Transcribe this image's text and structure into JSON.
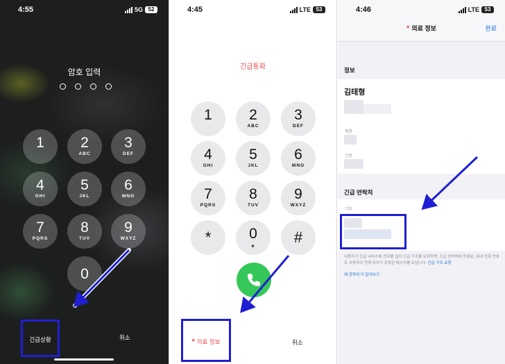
{
  "colors": {
    "annotation_blue": "#1e1ed2",
    "emergency_red": "#e44c50",
    "call_green": "#35c759",
    "link_blue": "#1a6fd9"
  },
  "lock_screen": {
    "status": {
      "time": "4:55",
      "network": "5G",
      "battery": "52"
    },
    "title": "암호 입력",
    "keys": [
      {
        "digit": "1",
        "letters": ""
      },
      {
        "digit": "2",
        "letters": "ABC"
      },
      {
        "digit": "3",
        "letters": "DEF"
      },
      {
        "digit": "4",
        "letters": "GHI"
      },
      {
        "digit": "5",
        "letters": "JKL"
      },
      {
        "digit": "6",
        "letters": "MNO"
      },
      {
        "digit": "7",
        "letters": "PQRS"
      },
      {
        "digit": "8",
        "letters": "TUV"
      },
      {
        "digit": "9",
        "letters": "WXYZ"
      },
      {
        "digit": "0",
        "letters": ""
      }
    ],
    "emergency_label": "긴급상황",
    "cancel_label": "취소"
  },
  "emergency_dialer": {
    "status": {
      "time": "4:45",
      "network": "LTE",
      "battery": "53"
    },
    "title": "긴급통화",
    "keys": [
      {
        "digit": "1",
        "letters": ""
      },
      {
        "digit": "2",
        "letters": "ABC"
      },
      {
        "digit": "3",
        "letters": "DEF"
      },
      {
        "digit": "4",
        "letters": "GHI"
      },
      {
        "digit": "5",
        "letters": "JKL"
      },
      {
        "digit": "6",
        "letters": "MNO"
      },
      {
        "digit": "7",
        "letters": "PQRS"
      },
      {
        "digit": "8",
        "letters": "TUV"
      },
      {
        "digit": "9",
        "letters": "WXYZ"
      },
      {
        "digit": "*",
        "letters": ""
      },
      {
        "digit": "0",
        "letters": "+"
      },
      {
        "digit": "#",
        "letters": ""
      }
    ],
    "medical_id_label": "의료 정보",
    "cancel_label": "취소",
    "asterisk": "*"
  },
  "medical_id": {
    "status": {
      "time": "4:46",
      "network": "LTE",
      "battery": "53"
    },
    "title": "의료 정보",
    "asterisk": "*",
    "done_label": "완료",
    "section_info": "정보",
    "name": "김태형",
    "label_weight": "체중",
    "label_height": "신장",
    "section_emergency": "긴급 연락처",
    "label_other": "기타",
    "note_text": "사용자가 긴급 서비스에 전화를 걸어 긴급 구조를 요청하면, 긴급 연락처에 등록된, 휴대 전화 번호로 사용자의 현재 위치가 포함된 메시지를 보냅니다.",
    "note_link": "긴급 구조 요청",
    "faq_link": "에 관하여 더 알아보기"
  }
}
